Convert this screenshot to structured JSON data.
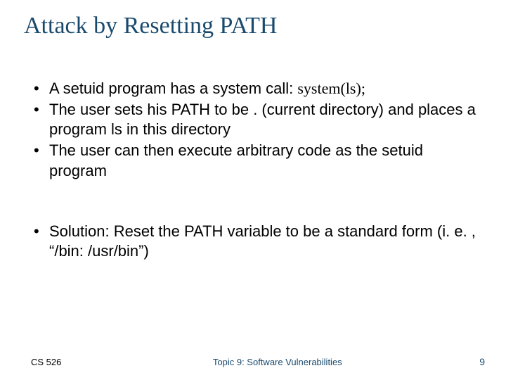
{
  "title": "Attack by Resetting PATH",
  "bullets_group1": [
    {
      "pre": "A setuid program has a system call: ",
      "code": "system(ls);",
      "post": ""
    },
    {
      "pre": "The user sets his PATH to be . (current directory) and places a program ls in this directory",
      "code": "",
      "post": ""
    },
    {
      "pre": "The user can then execute arbitrary code as the setuid program",
      "code": "",
      "post": ""
    }
  ],
  "bullets_group2": [
    {
      "pre": "Solution: Reset the PATH variable to be a standard form (i. e. , “/bin: /usr/bin”)",
      "code": "",
      "post": ""
    }
  ],
  "footer": {
    "left": "CS 526",
    "center": "Topic 9: Software Vulnerabilities",
    "right": "9"
  }
}
